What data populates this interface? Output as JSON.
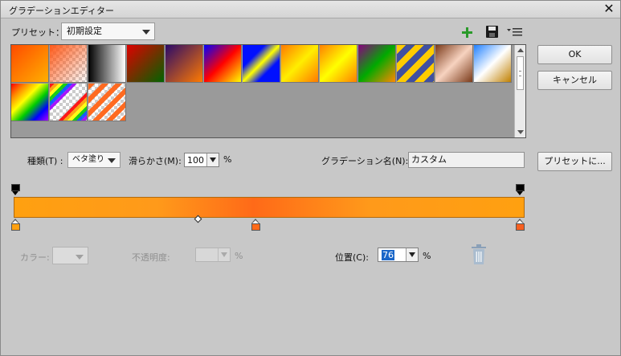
{
  "window": {
    "title": "グラデーションエディター",
    "close_glyph": "✕"
  },
  "preset": {
    "label": "プリセット：",
    "value": "初期設定",
    "toolbar": [
      "add-icon",
      "save-icon",
      "menu-icon"
    ]
  },
  "buttons": {
    "ok": "OK",
    "cancel": "キャンセル",
    "preset_to": "プリセットに..."
  },
  "swatches": [
    "linear-gradient(135deg,#ff4a00,#ffb000)",
    "checker:#ff5a1a",
    "linear-gradient(90deg,#000,#fff)",
    "linear-gradient(135deg,#e00000,#006400)",
    "linear-gradient(135deg,#2a0a6a,#ff7a00)",
    "linear-gradient(135deg,#0000ff,#ff0000,#ffff00)",
    "linear-gradient(135deg,#0010ff 30%,#ffff00 50%,#0010ff 70%)",
    "linear-gradient(135deg,#ff7a00,#ffee00,#ff7a00)",
    "linear-gradient(135deg,#ff8000,#ffff00,#ff8000)",
    "linear-gradient(135deg,#8a0080,#00aa00,#ff8800)",
    "repeating-linear-gradient(135deg,#ffcc00 0 8px,#4050a0 8px 16px)",
    "linear-gradient(135deg,#7a3a1a,#f7d3c0,#7a3a1a)",
    "linear-gradient(135deg,#2080ff,#fff,#c08000)",
    "linear-gradient(135deg,#ff0000,#ff8800,#ffff00,#00cc00,#0000ff,#aa00ff)",
    "checker-rainbow",
    "checker-stripes"
  ],
  "type": {
    "label": "種類(T) :",
    "value": "ベタ塗り"
  },
  "smooth": {
    "label": "滑らかさ(M):",
    "value": "100",
    "unit": "%"
  },
  "gradient_name": {
    "label": "グラデーション名(N):",
    "value": "カスタム"
  },
  "gradient": {
    "colors": [
      "#ffa010",
      "#ff9a1a",
      "#ff6a18",
      "#ff9a1a",
      "#ffa010"
    ],
    "stops": [
      0,
      0.28,
      0.47,
      0.7,
      1
    ]
  },
  "color_stop": {
    "label": "カラー:"
  },
  "opacity": {
    "label": "不透明度:",
    "unit": "%"
  },
  "location": {
    "label": "位置(C):",
    "value": "76",
    "unit": "%"
  },
  "delete_icon": "trash-icon"
}
